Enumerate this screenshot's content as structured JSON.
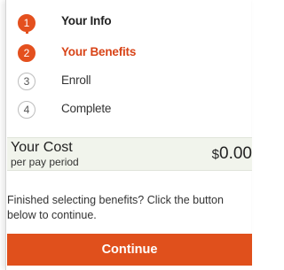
{
  "steps": [
    {
      "number": "1",
      "label": "Your Info",
      "state": "done"
    },
    {
      "number": "2",
      "label": "Your Benefits",
      "state": "active"
    },
    {
      "number": "3",
      "label": "Enroll",
      "state": "todo"
    },
    {
      "number": "4",
      "label": "Complete",
      "state": "todo"
    }
  ],
  "cost": {
    "title": "Your Cost",
    "subtitle": "per pay period",
    "currency": "$",
    "amount": "0.00"
  },
  "finished_message": "Finished selecting benefits? Click the button below to continue.",
  "continue_label": "Continue",
  "colors": {
    "accent": "#e4501e",
    "cost_background": "#f1f4ec"
  }
}
